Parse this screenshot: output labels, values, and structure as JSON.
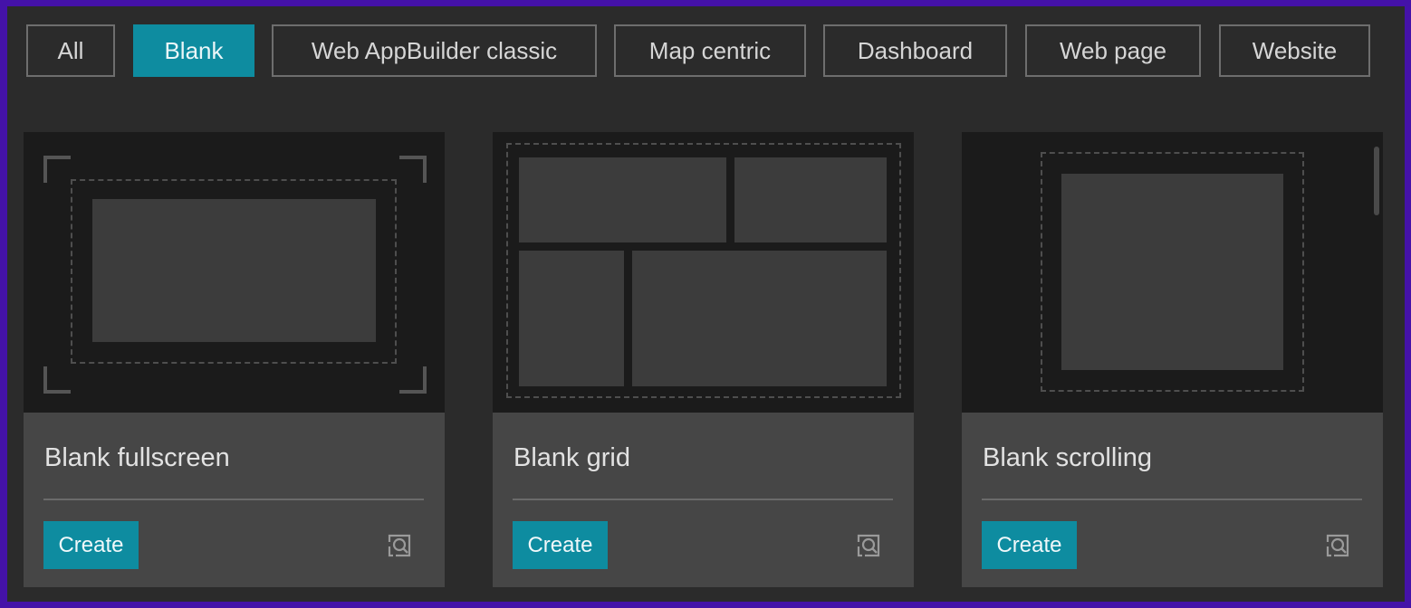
{
  "filters": [
    {
      "label": "All",
      "active": false
    },
    {
      "label": "Blank",
      "active": true
    },
    {
      "label": "Web AppBuilder classic",
      "active": false
    },
    {
      "label": "Map centric",
      "active": false
    },
    {
      "label": "Dashboard",
      "active": false
    },
    {
      "label": "Web page",
      "active": false
    },
    {
      "label": "Website",
      "active": false
    }
  ],
  "cards": [
    {
      "title": "Blank fullscreen",
      "create_label": "Create",
      "preview_icon": "preview-magnifier-icon"
    },
    {
      "title": "Blank grid",
      "create_label": "Create",
      "preview_icon": "preview-magnifier-icon"
    },
    {
      "title": "Blank scrolling",
      "create_label": "Create",
      "preview_icon": "preview-magnifier-icon"
    }
  ],
  "colors": {
    "accent": "#0e8ca0",
    "page_background": "#4412a8",
    "panel": "#2b2b2b",
    "card": "#464646",
    "thumbnail": "#1b1b1b"
  }
}
